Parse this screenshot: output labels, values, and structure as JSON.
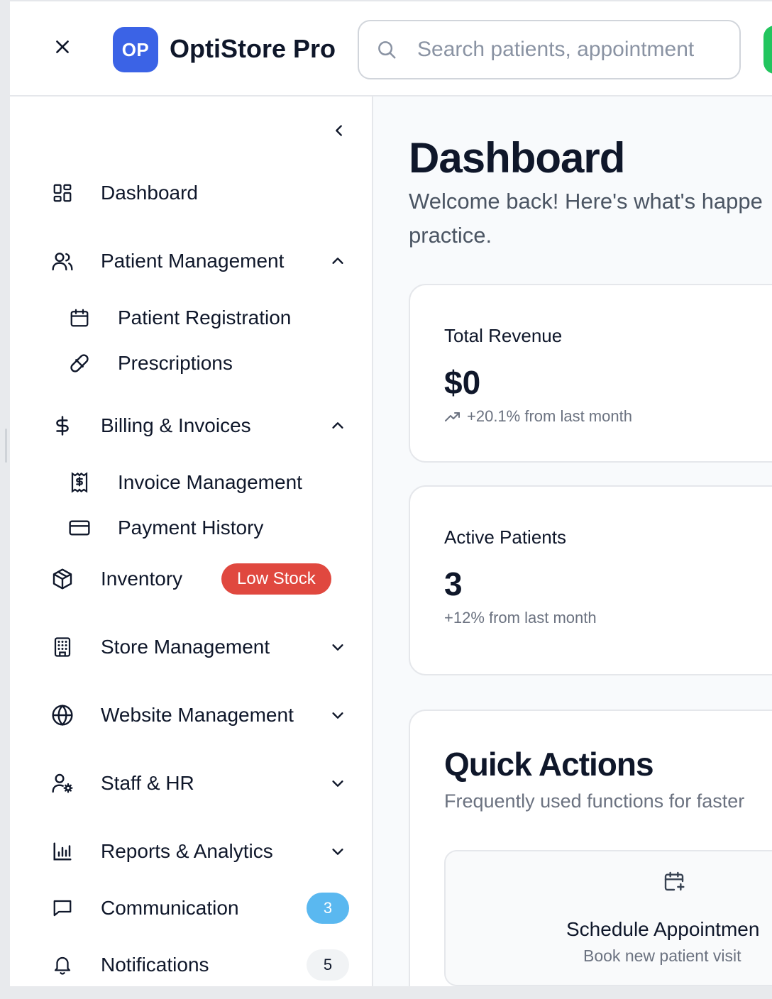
{
  "header": {
    "logo_initials": "OP",
    "app_title": "OptiStore Pro",
    "search_placeholder": "Search patients, appointment"
  },
  "sidebar": {
    "items": [
      {
        "label": "Dashboard",
        "icon": "dashboard-grid-icon"
      },
      {
        "label": "Patient Management",
        "icon": "users-icon",
        "expanded": true,
        "children": [
          {
            "label": "Patient Registration",
            "icon": "calendar-icon"
          },
          {
            "label": "Prescriptions",
            "icon": "pill-icon"
          }
        ]
      },
      {
        "label": "Billing & Invoices",
        "icon": "dollar-icon",
        "expanded": true,
        "children": [
          {
            "label": "Invoice Management",
            "icon": "receipt-icon"
          },
          {
            "label": "Payment History",
            "icon": "credit-card-icon"
          }
        ]
      },
      {
        "label": "Inventory",
        "icon": "package-icon",
        "badge": "Low Stock"
      },
      {
        "label": "Store Management",
        "icon": "building-icon",
        "expanded": false
      },
      {
        "label": "Website Management",
        "icon": "globe-icon",
        "expanded": false
      },
      {
        "label": "Staff & HR",
        "icon": "user-cog-icon",
        "expanded": false
      },
      {
        "label": "Reports & Analytics",
        "icon": "bar-chart-icon",
        "expanded": false
      },
      {
        "label": "Communication",
        "icon": "message-icon",
        "count": "3"
      },
      {
        "label": "Notifications",
        "icon": "bell-icon",
        "count": "5"
      }
    ]
  },
  "main": {
    "title": "Dashboard",
    "subtitle": "Welcome back! Here's what's happe practice.",
    "subtitle_line1": "Welcome back! Here's what's happe",
    "subtitle_line2": "practice.",
    "cards": [
      {
        "title": "Total Revenue",
        "value": "$0",
        "footer": "+20.1% from last month",
        "trend_icon": "trending-up-icon"
      },
      {
        "title": "Active Patients",
        "value": "3",
        "footer": "+12% from last month"
      }
    ],
    "quick_actions": {
      "title": "Quick Actions",
      "subtitle": "Frequently used functions for faster",
      "tiles": [
        {
          "title": "Schedule Appointmen",
          "subtitle": "Book new patient visit",
          "icon": "calendar-plus-icon"
        }
      ]
    }
  },
  "colors": {
    "brand": "#3b63e6",
    "low_stock": "#e0483f",
    "comm_badge": "#5ab8f0",
    "action_green": "#22c55e"
  }
}
